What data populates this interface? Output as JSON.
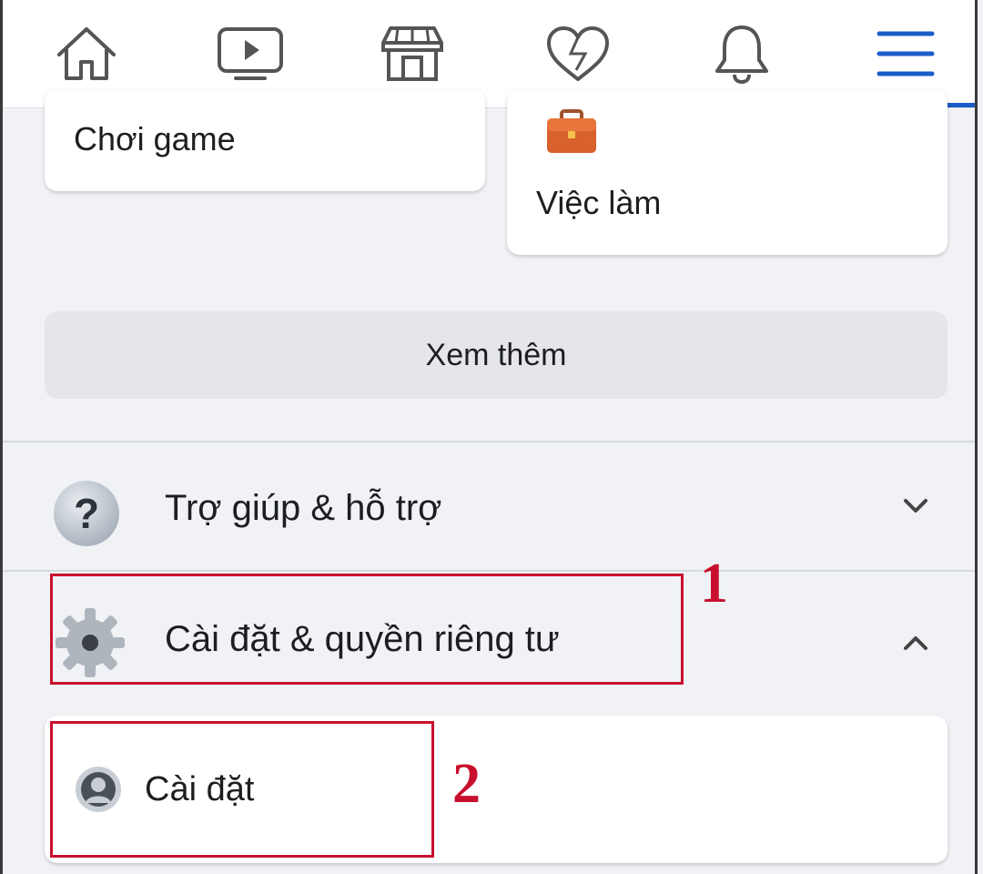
{
  "nav": {
    "icons": [
      "home-icon",
      "video-icon",
      "marketplace-icon",
      "dating-icon",
      "notifications-icon",
      "menu-icon"
    ],
    "active": "menu-icon",
    "accent": "#1a5cc8"
  },
  "shortcuts": {
    "gaming_label": "Chơi game",
    "jobs_label": "Việc làm"
  },
  "see_more_label": "Xem thêm",
  "help": {
    "label": "Trợ giúp & hỗ trợ",
    "icon": "question-icon"
  },
  "settings_privacy": {
    "label": "Cài đặt & quyền riêng tư",
    "icon": "gear-icon"
  },
  "settings": {
    "label": "Cài đặt",
    "icon": "profile-icon"
  },
  "annotations": {
    "step1": "1",
    "step2": "2",
    "color": "#c8102e"
  }
}
